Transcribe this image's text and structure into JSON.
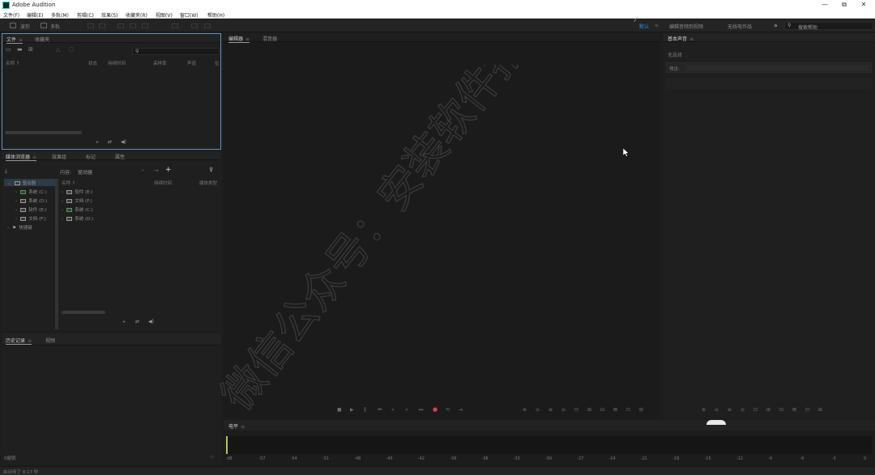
{
  "app": {
    "title": "Adobe Audition"
  },
  "window_controls": {
    "minimize": "—",
    "maximize": "⧉",
    "close": "✕"
  },
  "menu": [
    "文件(F)",
    "编辑(E)",
    "多轨(M)",
    "剪辑(C)",
    "效果(S)",
    "收藏夹(R)",
    "视图(V)",
    "窗口(W)",
    "帮助(H)"
  ],
  "toolbar": {
    "waveform_label": "波形",
    "multitrack_label": "多轨",
    "workspace_default": "默认",
    "workspace_tabs": [
      "编辑音频到视频",
      "无线电作品"
    ],
    "more": "»",
    "search_placeholder": "搜索帮助"
  },
  "files_panel": {
    "tabs": [
      {
        "label": "文件",
        "active": true
      },
      {
        "label": "收藏夹",
        "active": false
      }
    ],
    "columns": [
      "名称 ↑",
      "状态",
      "持续时间",
      "采样率",
      "声道",
      "位"
    ]
  },
  "media_panel": {
    "tabs": [
      {
        "label": "媒体浏览器",
        "active": true
      },
      {
        "label": "效果组",
        "active": false
      },
      {
        "label": "标记",
        "active": false
      },
      {
        "label": "属性",
        "active": false
      }
    ],
    "content_label": "内容:",
    "content_value": "驱动器",
    "tree": [
      {
        "label": "驱动器",
        "level": 0,
        "green": false
      },
      {
        "label": "系统 (C:)",
        "level": 1,
        "green": true
      },
      {
        "label": "系统 (D:)",
        "level": 1,
        "green": false
      },
      {
        "label": "软件 (E:)",
        "level": 1,
        "green": false
      },
      {
        "label": "文档 (F:)",
        "level": 1,
        "green": false
      },
      {
        "label": "快捷键",
        "level": 0,
        "green": false
      }
    ],
    "columns": [
      "名称 ↑",
      "持续时间",
      "媒体类型"
    ],
    "list": [
      {
        "label": "软件 (E:)",
        "green": false
      },
      {
        "label": "文档 (F:)",
        "green": false
      },
      {
        "label": "系统 (C:)",
        "green": true
      },
      {
        "label": "系统 (D:)",
        "green": false
      }
    ]
  },
  "history_panel": {
    "tabs": [
      {
        "label": "历史记录",
        "active": true
      },
      {
        "label": "视频",
        "active": false
      }
    ],
    "undo_count": "0撤销",
    "status": "启动用了 8.17 秒"
  },
  "editor_panel": {
    "tabs": [
      {
        "label": "编辑器",
        "active": true
      },
      {
        "label": "混音器",
        "active": false
      }
    ]
  },
  "essential_sound": {
    "title": "基本声音",
    "no_selection": "无选择",
    "preset_label": "预设:"
  },
  "meter": {
    "label": "电平",
    "scale": [
      "dB",
      "-57",
      "-54",
      "-51",
      "-48",
      "-45",
      "-42",
      "-39",
      "-36",
      "-33",
      "-30",
      "-27",
      "-24",
      "-21",
      "-18",
      "-15",
      "-12",
      "-9",
      "-6",
      "-3",
      "0"
    ]
  },
  "watermark": {
    "text": "微信公众号：安装软件指南"
  },
  "colors": {
    "accent": "#2d8ceb",
    "record": "#e0404a",
    "panel_focus": "#6b8fb8"
  }
}
